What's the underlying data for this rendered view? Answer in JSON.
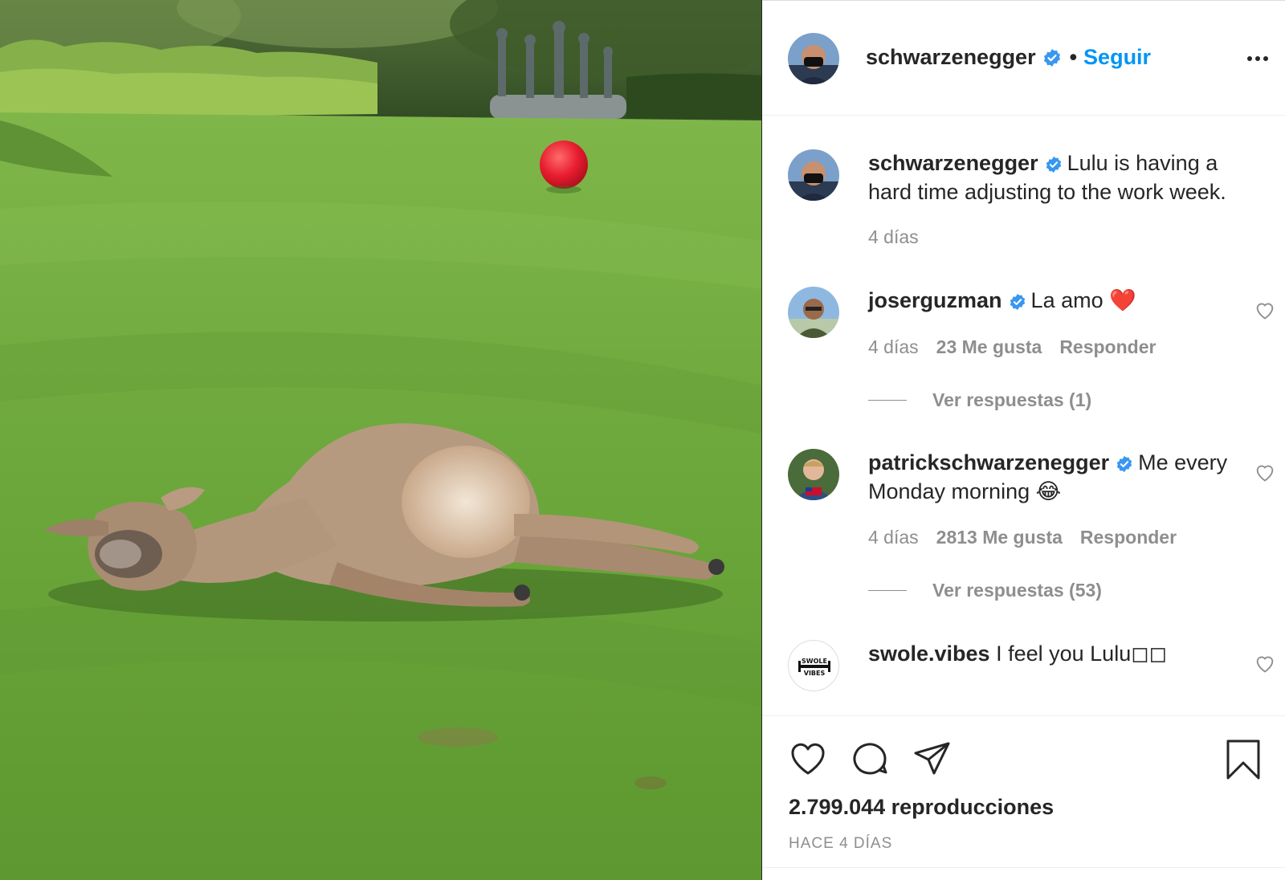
{
  "post": {
    "username": "schwarzenegger",
    "follow_label": "Seguir",
    "separator": "•",
    "caption_user": "schwarzenegger",
    "caption_text": "Lulu is having a hard time adjusting to the work week.",
    "caption_time": "4 días"
  },
  "comments": [
    {
      "user": "joserguzman",
      "text": "La amo",
      "emoji": "❤️",
      "time": "4 días",
      "likes": "23 Me gusta",
      "reply_label": "Responder",
      "view_replies": "Ver respuestas (1)"
    },
    {
      "user": "patrickschwarzenegger",
      "text": "Me every Monday morning",
      "emoji": "😂",
      "time": "4 días",
      "likes": "2813 Me gusta",
      "reply_label": "Responder",
      "view_replies": "Ver respuestas (53)"
    },
    {
      "user": "swole.vibes",
      "text": "I feel you Lulu◻◻",
      "avatar_text_top": "SWOLE",
      "avatar_text_bottom": "VIBES"
    }
  ],
  "footer": {
    "views": "2.799.044 reproducciones",
    "time_ago": "HACE 4 DÍAS"
  },
  "icons": {
    "verified": "verified-badge-icon",
    "like": "heart-icon",
    "comment": "comment-bubble-icon",
    "share": "paper-plane-icon",
    "save": "bookmark-icon",
    "more": "more-options-icon"
  },
  "colors": {
    "link_blue": "#0095f6",
    "verified_blue": "#3897f0",
    "text": "#262626",
    "muted": "#8e8e8e",
    "grass": "#6aa53a"
  }
}
